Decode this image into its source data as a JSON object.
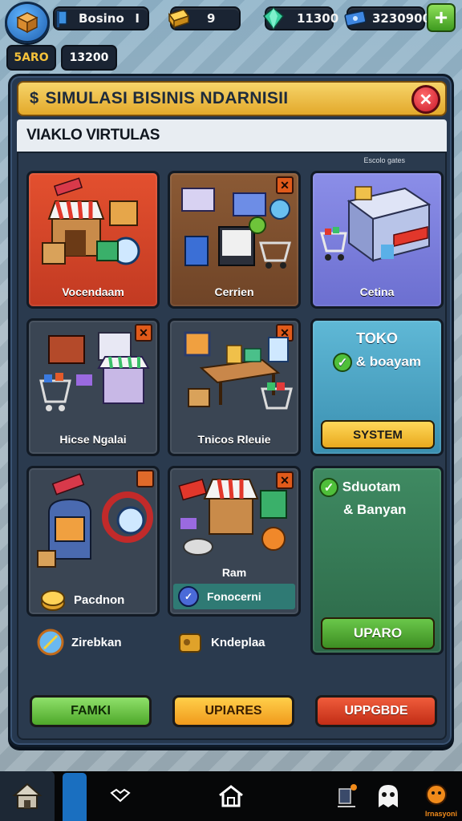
{
  "hud": {
    "resource1": "Bosino",
    "resource1_suffix": "I",
    "resource2": "9",
    "resource3": "11300",
    "resource4": "3230900",
    "plus": "+",
    "sub_left": "5ARO",
    "sub_right": "13200"
  },
  "panel": {
    "title_prefix": "$",
    "title": "SIMULASI BISINIS NDARNISII",
    "close": "✕",
    "subtitle": "VIAKLO VIRTULAS",
    "corner_label": "Escolo gates"
  },
  "cards": {
    "c1": "Vocendaam",
    "c2": "Cerrien",
    "c3": "Cetina",
    "c4": "Hicse Ngalai",
    "c5": "Tnicos Rleuie",
    "c6_caption": "Ram",
    "c6_label": "Fonocerni"
  },
  "toko": {
    "line1": "TOKO",
    "line2": "& boayam",
    "button": "SYSTEM"
  },
  "solution": {
    "line1": "Sduotam",
    "line2": "& Banyan",
    "button": "UPARO"
  },
  "bottom_items": {
    "pacdnon": "Pacdnon",
    "zirebkan": "Zirebkan",
    "kndeplaa": "Kndeplaa"
  },
  "buttons": {
    "left": "FAMKI",
    "center": "UPIARES",
    "right": "UPPGBDE"
  },
  "nav": {
    "badge_label": "Irnasyoni"
  },
  "colors": {
    "accent_gold": "#f5c23a",
    "close_red": "#c9182a",
    "panel_bg": "#26384f"
  }
}
